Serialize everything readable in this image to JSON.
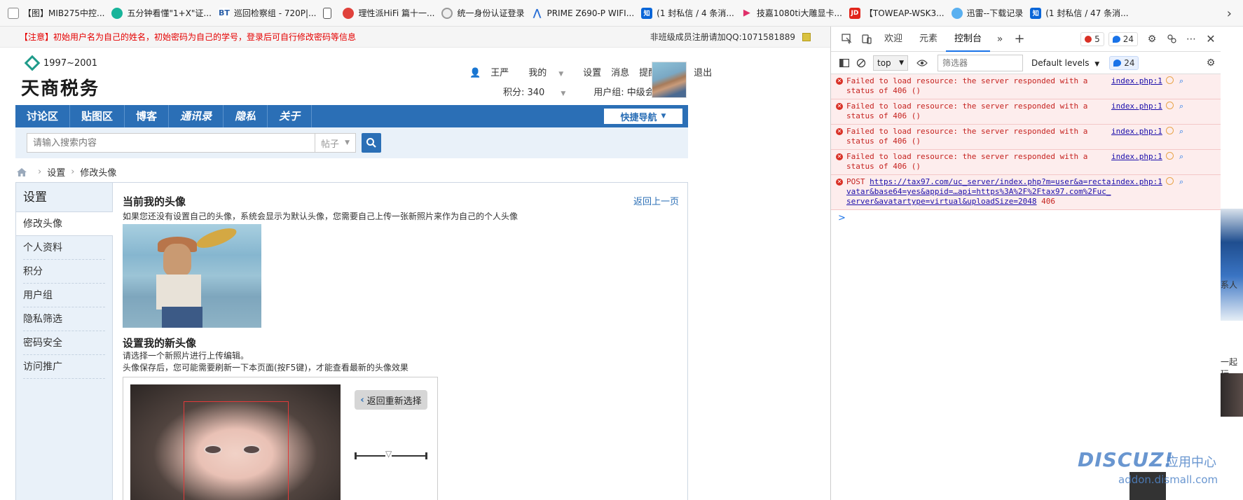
{
  "bookmarks": [
    {
      "icon": "page-icon",
      "label": "【图】MIB275中控..."
    },
    {
      "icon": "heart-icon",
      "label": "五分钟看懂\"1+X\"证..."
    },
    {
      "icon": "bt-icon",
      "label": "巡回检察组 - 720P|..."
    },
    {
      "icon": "doc-icon",
      "label": ""
    },
    {
      "icon": "hifi-icon",
      "label": "理性派HiFi 篇十一..."
    },
    {
      "icon": "gear-icon",
      "label": "统一身份认证登录"
    },
    {
      "icon": "triangle-icon",
      "label": "PRIME Z690-P WIFI..."
    },
    {
      "icon": "zhihu-icon",
      "label": "(1 封私信 / 4 条消..."
    },
    {
      "icon": "play-icon",
      "label": "技嘉1080ti大雕显卡..."
    },
    {
      "icon": "jd-icon",
      "label": "【TOWEAP-WSK3..."
    },
    {
      "icon": "cloud-icon",
      "label": "迅雷--下载记录"
    },
    {
      "icon": "zhihu-icon",
      "label": "(1 封私信 / 47 条消..."
    }
  ],
  "notice": {
    "left": "【注意】初始用户名为自己的姓名，初始密码为自己的学号，登录后可自行修改密码等信息",
    "right": "非班级成员注册请加QQ:1071581889"
  },
  "site": {
    "years": "1997~2001",
    "name": "天商税务"
  },
  "user_menu": {
    "name": "王严",
    "mine": "我的",
    "settings": "设置",
    "messages": "消息",
    "reminders": "提醒",
    "logout": "退出",
    "points": "积分: 340",
    "usergroup": "用户组: 中级会员"
  },
  "nav": {
    "items": [
      "讨论区",
      "贴图区",
      "博客",
      "通讯录",
      "隐私",
      "关于"
    ],
    "quick": "快捷导航"
  },
  "search": {
    "placeholder": "请输入搜索内容",
    "type": "帖子"
  },
  "breadcrumb": {
    "items": [
      "设置",
      "修改头像"
    ]
  },
  "sidebar": {
    "title": "设置",
    "items": [
      "修改头像",
      "个人资料",
      "积分",
      "用户组",
      "隐私筛选",
      "密码安全",
      "访问推广"
    ]
  },
  "main": {
    "current_title": "当前我的头像",
    "back": "返回上一页",
    "current_desc": "如果您还没有设置自己的头像，系统会显示为默认头像，您需要自己上传一张新照片来作为自己的个人头像",
    "new_title": "设置我的新头像",
    "new_desc1": "请选择一个新照片进行上传编辑。",
    "new_desc2": "头像保存后，您可能需要刷新一下本页面(按F5键)，才能查看最新的头像效果",
    "reselect": "返回重新选择"
  },
  "devtools": {
    "tabs": [
      "欢迎",
      "元素",
      "控制台"
    ],
    "active_tab": "控制台",
    "error_count": "5",
    "info_count": "24",
    "context": "top",
    "filter_placeholder": "筛选器",
    "levels": "Default levels",
    "messages_badge": "24",
    "messages": [
      {
        "text": "Failed to load resource: the server responded with a status of 406 ()",
        "source": "index.php:1"
      },
      {
        "text": "Failed to load resource: the server responded with a status of 406 ()",
        "source": "index.php:1"
      },
      {
        "text": "Failed to load resource: the server responded with a status of 406 ()",
        "source": "index.php:1"
      },
      {
        "text": "Failed to load resource: the server responded with a status of 406 ()",
        "source": "index.php:1"
      }
    ],
    "post": {
      "method": "POST",
      "url": "https://tax97.com/uc_server/index.php?m=user&a=rectavatar&base64=yes&appid=…api=https%3A%2F%2Ftax97.com%2Fuc_server&avatartype=virtual&uploadSize=2048",
      "status": "406",
      "source": "index.php:1"
    },
    "prompt": ">"
  },
  "right_strip": {
    "t1": "系人",
    "t2": "一起玩"
  },
  "watermark": {
    "logo": "DISCUZ!",
    "cn": "应用中心",
    "url": "addon.dismall.com"
  },
  "colors": {
    "nav_blue": "#2b6fb6",
    "error_red": "#d93025",
    "notice_red": "#e50000"
  }
}
